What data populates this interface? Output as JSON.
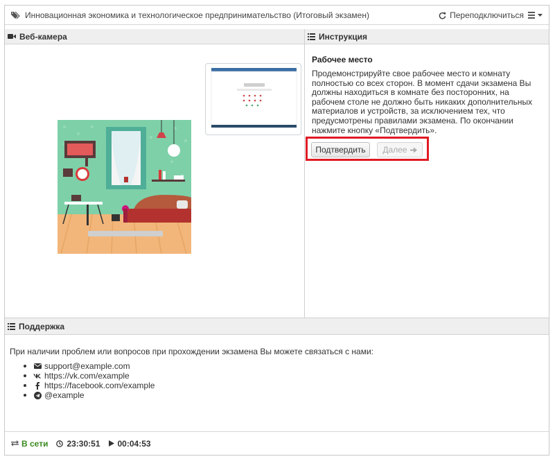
{
  "header": {
    "title": "Инновационная экономика и технологическое предпринимательство (Итоговый экзамен)",
    "reconnect_label": "Переподключиться",
    "tag_icon": "tag-icon",
    "reconnect_icon": "refresh-icon",
    "menu_icon": "menu-icon"
  },
  "webcam": {
    "title": "Веб-камера",
    "icon": "video-camera-icon"
  },
  "instruction": {
    "title": "Инструкция",
    "icon": "list-icon",
    "heading": "Рабочее место",
    "text": "Продемонстрируйте свое рабочее место и комнату полностью со всех сторон. В момент сдачи экзамена Вы должны находиться в комнате без посторонних, на рабочем столе не должно быть никаких дополнительных материалов и устройств, за исключением тех, что предусмотрены правилами экзамена. По окончании нажмите кнопку «Подтвердить».",
    "confirm_label": "Подтвердить",
    "next_label": "Далее",
    "highlight_color": "#e01b24"
  },
  "support": {
    "title": "Поддержка",
    "icon": "list-icon",
    "text": "При наличии проблем или вопросов при прохождении экзамена Вы можете связаться с нами:",
    "contacts": [
      {
        "icon": "envelope-icon",
        "label": "support@example.com"
      },
      {
        "icon": "vk-icon",
        "label": "https://vk.com/example"
      },
      {
        "icon": "facebook-icon",
        "label": "https://facebook.com/example"
      },
      {
        "icon": "telegram-icon",
        "label": "@example"
      }
    ]
  },
  "status": {
    "online_label": "В сети",
    "clock": "23:30:51",
    "elapsed": "00:04:53",
    "online_color": "#3a8a1f"
  }
}
